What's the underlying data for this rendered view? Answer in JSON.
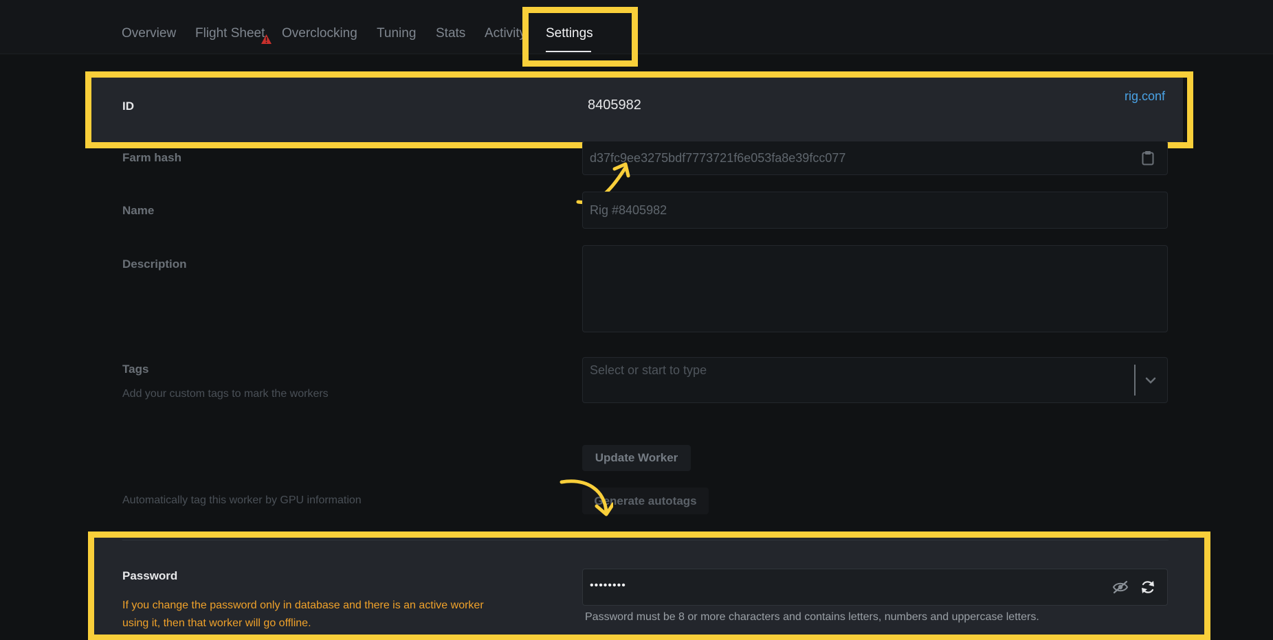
{
  "tabs": {
    "overview": "Overview",
    "flight_sheet": "Flight Sheet",
    "overclocking": "Overclocking",
    "tuning": "Tuning",
    "stats": "Stats",
    "activity": "Activity",
    "settings": "Settings"
  },
  "id_row": {
    "label": "ID",
    "value": "8405982",
    "link": "rig.conf"
  },
  "farm_hash": {
    "label": "Farm hash",
    "value": "d37fc9ee3275bdf7773721f6e053fa8e39fcc077"
  },
  "name": {
    "label": "Name",
    "value": "Rig #8405982"
  },
  "description": {
    "label": "Description",
    "value": ""
  },
  "tags": {
    "label": "Tags",
    "sublabel": "Add your custom tags to mark the workers",
    "placeholder": "Select or start to type"
  },
  "update_button": "Update Worker",
  "autotags": {
    "label": "Automatically tag this worker by GPU information",
    "button": "Generate autotags"
  },
  "password": {
    "label": "Password",
    "warning_line1": "If you change the password only in database and there is an active worker",
    "warning_line2": "using it, then that worker will go offline.",
    "value": "••••••••",
    "hint": "Password must be 8 or more characters and contains letters, numbers and uppercase letters."
  },
  "colors": {
    "highlight": "#f9cf3a",
    "link": "#4aa3e6",
    "warning": "#f0a22a",
    "background": "#101214"
  }
}
